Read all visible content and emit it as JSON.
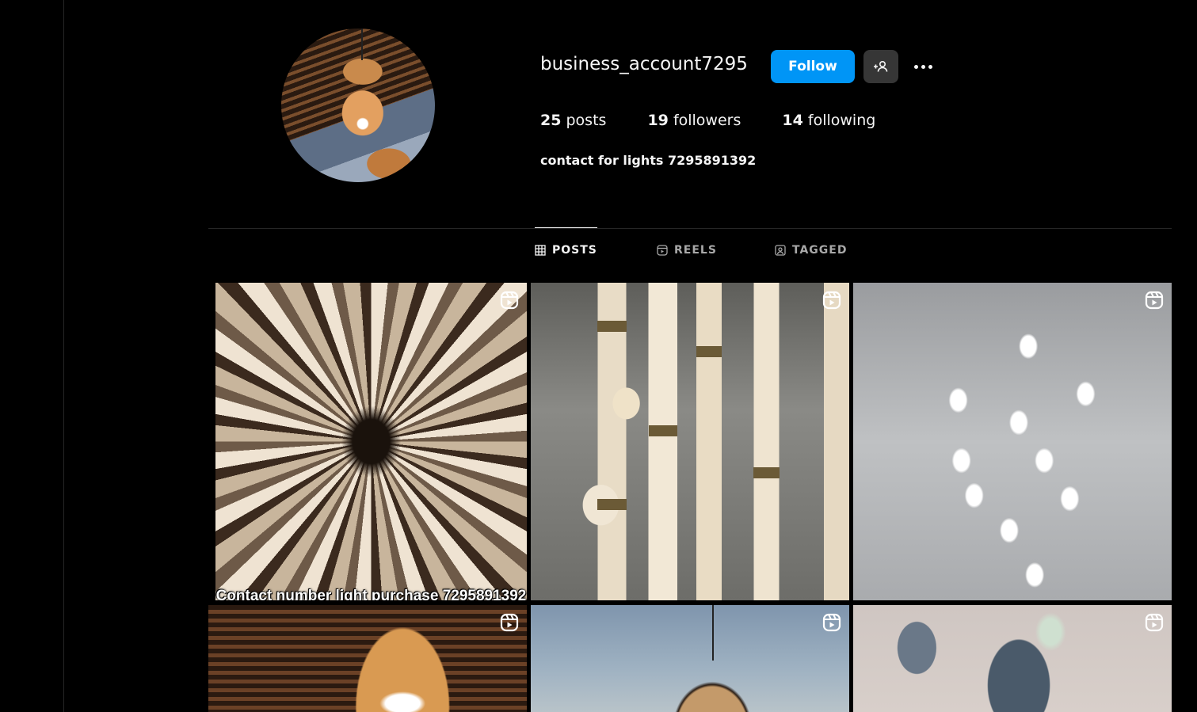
{
  "profile": {
    "username": "business_account7295",
    "follow_label": "Follow",
    "stats": {
      "posts_count": "25",
      "posts_label": "posts",
      "followers_count": "19",
      "followers_label": "followers",
      "following_count": "14",
      "following_label": "following"
    },
    "bio": "contact for lights 7295891392"
  },
  "tabs": [
    {
      "label": "POSTS",
      "icon": "grid-icon",
      "active": true
    },
    {
      "label": "REELS",
      "icon": "reels-icon",
      "active": false
    },
    {
      "label": "TAGGED",
      "icon": "tagged-icon",
      "active": false
    }
  ],
  "posts": [
    {
      "type": "reel",
      "overlay_text": "Contact number light purchase 7295891392"
    },
    {
      "type": "reel"
    },
    {
      "type": "reel"
    },
    {
      "type": "reel"
    },
    {
      "type": "reel"
    },
    {
      "type": "reel"
    }
  ],
  "colors": {
    "background": "#000000",
    "accent": "#0095f6",
    "secondary_button": "#363636",
    "muted_text": "#a8a8a8"
  }
}
